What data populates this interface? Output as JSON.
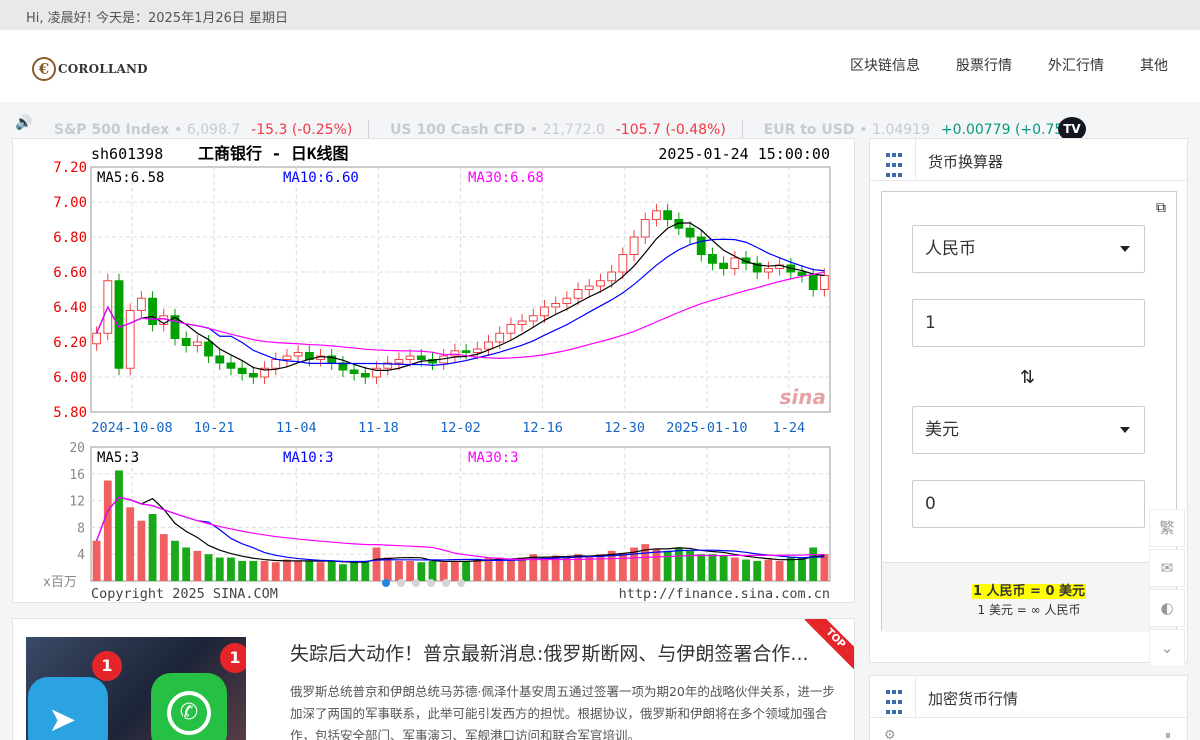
{
  "topbar": {
    "greeting": "Hi, 凌晨好!   今天是：2025年1月26日 星期日"
  },
  "header": {
    "logo_text": "COROLLAND",
    "logo_symbol": "€",
    "nav": [
      "区块链信息",
      "股票行情",
      "外汇行情",
      "其他"
    ]
  },
  "ticker": {
    "items": [
      {
        "name": "S&P 500 Index",
        "value": "6,098.7",
        "change": "-15.3 (-0.25%)",
        "direction": "down"
      },
      {
        "name": "US 100 Cash CFD",
        "value": "21,772.0",
        "change": "-105.7 (-0.48%)",
        "direction": "down"
      },
      {
        "name": "EUR to USD",
        "value": "1.04919",
        "change": "+0.00779 (+0.75%)",
        "direction": "up"
      }
    ],
    "tv_logo": "TV",
    "colors": {
      "down": "#f23645",
      "up": "#089981"
    }
  },
  "chart_data": {
    "type": "candlestick",
    "symbol": "sh601398",
    "title": "工商银行 - 日K线图",
    "datetime": "2025-01-24 15:00:00",
    "ma_labels": [
      "MA5:6.58",
      "MA10:6.60",
      "MA30:6.68"
    ],
    "ma_colors": [
      "#000000",
      "#0000ff",
      "#ff00ff"
    ],
    "ylim": [
      5.8,
      7.2
    ],
    "yticks": [
      "7.20",
      "7.00",
      "6.80",
      "6.60",
      "6.40",
      "6.20",
      "6.00",
      "5.80"
    ],
    "xticks": [
      "2024-10-08",
      "10-21",
      "11-04",
      "11-18",
      "12-02",
      "12-16",
      "12-30",
      "2025-01-10",
      "1-24"
    ],
    "close": [
      6.25,
      6.55,
      6.05,
      6.38,
      6.45,
      6.3,
      6.35,
      6.22,
      6.18,
      6.2,
      6.12,
      6.08,
      6.05,
      6.02,
      6.0,
      6.05,
      6.1,
      6.12,
      6.14,
      6.1,
      6.12,
      6.08,
      6.04,
      6.02,
      6.0,
      6.05,
      6.08,
      6.1,
      6.12,
      6.1,
      6.08,
      6.12,
      6.15,
      6.14,
      6.16,
      6.2,
      6.25,
      6.3,
      6.32,
      6.35,
      6.4,
      6.42,
      6.45,
      6.5,
      6.52,
      6.55,
      6.6,
      6.7,
      6.8,
      6.9,
      6.95,
      6.9,
      6.85,
      6.8,
      6.7,
      6.65,
      6.62,
      6.68,
      6.65,
      6.6,
      6.62,
      6.64,
      6.6,
      6.58,
      6.5,
      6.58
    ],
    "volume_ylim": [
      0,
      20
    ],
    "volume_yticks": [
      "20",
      "16",
      "12",
      "8",
      "4"
    ],
    "volume_ma_labels": [
      "MA5:3",
      "MA10:3",
      "MA30:3"
    ],
    "volume_unit": "x百万",
    "volumes": [
      6,
      15,
      16.5,
      11,
      9,
      10,
      7,
      6,
      5,
      4.5,
      4,
      3.5,
      3.5,
      3,
      3,
      3,
      2.8,
      3.2,
      3,
      3,
      2.8,
      3,
      2.5,
      2.8,
      3,
      5,
      3.5,
      3,
      3,
      2.8,
      3,
      2.8,
      3,
      3,
      3.2,
      3.5,
      3.5,
      3.2,
      3.5,
      4,
      3.5,
      3.8,
      3.5,
      4,
      3.8,
      4,
      4.5,
      4.2,
      5,
      5.5,
      4.8,
      4.5,
      5,
      4.5,
      4,
      4,
      3.8,
      3.5,
      3.2,
      3,
      3.2,
      3,
      3.5,
      3.5,
      5,
      4
    ],
    "copyright": "Copyright 2025 SINA.COM",
    "source_url": "http://finance.sina.com.cn",
    "watermark": "sina",
    "up_color": "#ee4444",
    "down_color": "#00a000"
  },
  "carousel": {
    "count": 6,
    "active": 0
  },
  "news": {
    "title": "失踪后大动作！普京最新消息:俄罗斯断网、与伊朗签署合作...",
    "summary": "俄罗斯总统普京和伊朗总统马苏德·佩泽什基安周五通过签署一项为期20年的战略伙伴关系，进一步加深了两国的军事联系，此举可能引发西方的担忧。根据协议，俄罗斯和伊朗将在多个领域加强合作，包括安全部门、军事演习、军舰港口访问和联合军官培训。",
    "ribbon": "TOP",
    "badges": [
      "1",
      "1"
    ]
  },
  "converter": {
    "title": "货币换算器",
    "from_currency": "人民币",
    "amount": "1",
    "to_currency": "美元",
    "result": "0",
    "rate_main": "1 人民币 = 0 美元",
    "rate_inverse": "1 美元 = ∞ 人民币"
  },
  "crypto": {
    "title": "加密货币行情"
  },
  "float_tools": {
    "traditional": "繁"
  }
}
